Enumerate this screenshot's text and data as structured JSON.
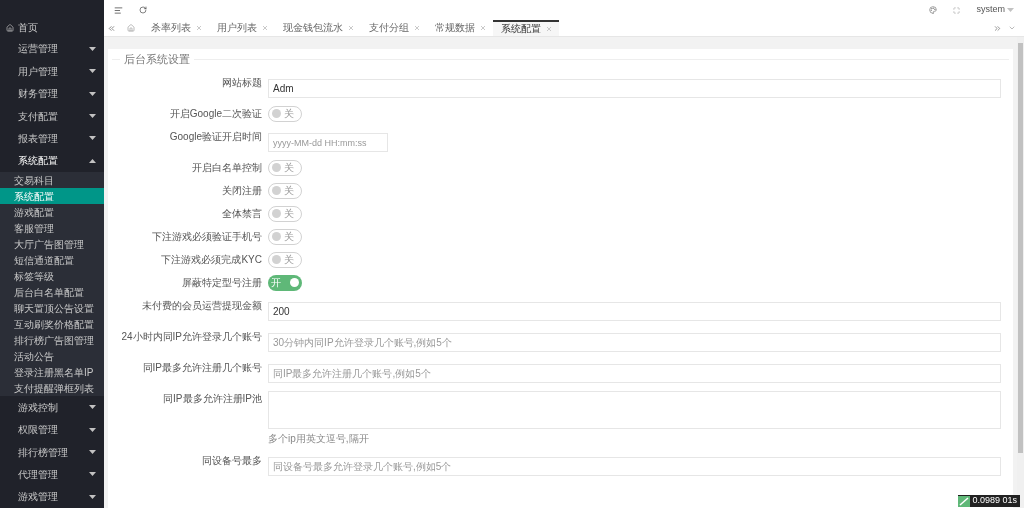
{
  "header": {
    "user": "system"
  },
  "sidebar": {
    "home": "首页",
    "items": [
      {
        "label": "运营管理",
        "expanded": false
      },
      {
        "label": "用户管理",
        "expanded": false
      },
      {
        "label": "财务管理",
        "expanded": false
      },
      {
        "label": "支付配置",
        "expanded": false
      },
      {
        "label": "报表管理",
        "expanded": false
      },
      {
        "label": "系统配置",
        "expanded": true,
        "children": [
          {
            "label": "交易科目",
            "selected": false
          },
          {
            "label": "系统配置",
            "selected": true
          },
          {
            "label": "游戏配置",
            "selected": false
          },
          {
            "label": "客服管理",
            "selected": false
          },
          {
            "label": "大厅广告图管理",
            "selected": false
          },
          {
            "label": "短信通道配置",
            "selected": false
          },
          {
            "label": "标签等级",
            "selected": false
          },
          {
            "label": "后台白名单配置",
            "selected": false
          },
          {
            "label": "聊天置顶公告设置",
            "selected": false
          },
          {
            "label": "互动刷奖价格配置",
            "selected": false
          },
          {
            "label": "排行榜广告图管理",
            "selected": false
          },
          {
            "label": "活动公告",
            "selected": false
          },
          {
            "label": "登录注册黑名单IP",
            "selected": false
          },
          {
            "label": "支付提醒弹框列表",
            "selected": false
          }
        ]
      },
      {
        "label": "游戏控制",
        "expanded": false
      },
      {
        "label": "权限管理",
        "expanded": false
      },
      {
        "label": "排行榜管理",
        "expanded": false
      },
      {
        "label": "代理管理",
        "expanded": false
      },
      {
        "label": "游戏管理",
        "expanded": false
      }
    ]
  },
  "tabs": [
    {
      "label": "杀率列表",
      "selected": false
    },
    {
      "label": "用户列表",
      "selected": false
    },
    {
      "label": "现金钱包流水",
      "selected": false
    },
    {
      "label": "支付分组",
      "selected": false
    },
    {
      "label": "常规数据",
      "selected": false
    },
    {
      "label": "系统配置",
      "selected": true
    }
  ],
  "form": {
    "title": "后台系统设置",
    "rows": [
      {
        "kind": "text",
        "label": "网站标题",
        "value": "Adm"
      },
      {
        "kind": "switch",
        "label": "开启Google二次验证",
        "on": false,
        "text": "关"
      },
      {
        "kind": "date",
        "label": "Google验证开启时间",
        "placeholder": "yyyy-MM-dd HH:mm:ss"
      },
      {
        "kind": "switch",
        "label": "开启白名单控制",
        "on": false,
        "text": "关"
      },
      {
        "kind": "switch",
        "label": "关闭注册",
        "on": false,
        "text": "关"
      },
      {
        "kind": "switch",
        "label": "全体禁言",
        "on": false,
        "text": "关"
      },
      {
        "kind": "switch",
        "label": "下注游戏必须验证手机号",
        "on": false,
        "text": "关"
      },
      {
        "kind": "switch",
        "label": "下注游戏必须完成KYC",
        "on": false,
        "text": "关"
      },
      {
        "kind": "switch",
        "label": "屏蔽特定型号注册",
        "on": true,
        "text": "开"
      },
      {
        "kind": "text",
        "label": "未付费的会员运营提现金额",
        "value": "200"
      },
      {
        "kind": "text",
        "label": "24小时内同IP允许登录几个账号",
        "placeholder": "30分钟内同IP允许登录几个账号,例如5个"
      },
      {
        "kind": "text",
        "label": "同IP最多允许注册几个账号",
        "placeholder": "同IP最多允许注册几个账号,例如5个"
      },
      {
        "kind": "textarea",
        "label": "同IP最多允许注册IP池",
        "hint": "多个ip用英文逗号,隔开"
      },
      {
        "kind": "text",
        "label": "同设备号最多",
        "placeholder": "同设备号最多允许登录几个账号,例如5个"
      }
    ]
  },
  "badge": {
    "text": "0.0989 01s"
  }
}
